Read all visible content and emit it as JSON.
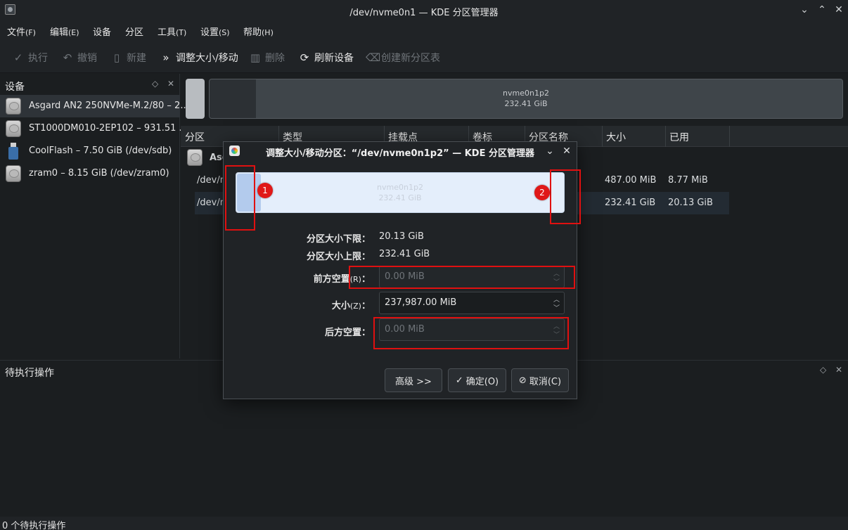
{
  "window": {
    "title": "/dev/nvme0n1 — KDE 分区管理器"
  },
  "menubar": [
    {
      "label": "文件",
      "accel": "(F)"
    },
    {
      "label": "编辑",
      "accel": "(E)"
    },
    {
      "label": "设备",
      "accel": ""
    },
    {
      "label": "分区",
      "accel": ""
    },
    {
      "label": "工具",
      "accel": "(T)"
    },
    {
      "label": "设置",
      "accel": "(S)"
    },
    {
      "label": "帮助",
      "accel": "(H)"
    }
  ],
  "toolbar": [
    {
      "label": "执行",
      "icon": "check-icon",
      "enabled": false
    },
    {
      "label": "撤销",
      "icon": "undo-icon",
      "enabled": false
    },
    {
      "label": "新建",
      "icon": "new-doc-icon",
      "enabled": false
    },
    {
      "label": "调整大小/移动",
      "icon": "resize-icon",
      "enabled": true
    },
    {
      "label": "删除",
      "icon": "trash-icon",
      "enabled": false
    },
    {
      "label": "刷新设备",
      "icon": "refresh-icon",
      "enabled": true
    },
    {
      "label": "创建新分区表",
      "icon": "erase-icon",
      "enabled": false
    }
  ],
  "devices": {
    "header": "设备",
    "items": [
      {
        "label": "Asgard AN2 250NVMe-M.2/80 – 2...",
        "icon": "disk-icon",
        "selected": true
      },
      {
        "label": "ST1000DM010-2EP102 – 931.51 ...",
        "icon": "disk-icon",
        "selected": false
      },
      {
        "label": "CoolFlash – 7.50 GiB (/dev/sdb)",
        "icon": "usb-icon",
        "selected": false
      },
      {
        "label": "zram0 – 8.15 GiB (/dev/zram0)",
        "icon": "disk-icon",
        "selected": false
      }
    ]
  },
  "partition_graph": {
    "name": "nvme0n1p2",
    "size": "232.41 GiB"
  },
  "table": {
    "columns": [
      "分区",
      "类型",
      "挂载点",
      "卷标",
      "分区名称",
      "大小",
      "已用"
    ],
    "device_row": "Asgard",
    "rows": [
      {
        "partition": "/dev/n",
        "size": "487.00 MiB",
        "used": "8.77 MiB",
        "selected": false
      },
      {
        "partition": "/dev/n",
        "size": "232.41 GiB",
        "used": "20.13 GiB",
        "selected": true
      }
    ]
  },
  "pending": {
    "header": "待执行操作"
  },
  "statusbar": {
    "text": "0 个待执行操作"
  },
  "dialog": {
    "title": "调整大小/移动分区：“/dev/nvme0n1p2” — KDE 分区管理器",
    "resizer": {
      "name": "nvme0n1p2",
      "size": "232.41 GiB"
    },
    "markers": [
      "1",
      "2"
    ],
    "min_size_label": "分区大小下限：",
    "min_size_value": "20.13 GiB",
    "max_size_label": "分区大小上限：",
    "max_size_value": "232.41 GiB",
    "free_before_label": "前方空置",
    "free_before_accel": "(R)",
    "free_before_value": "0.00 MiB",
    "size_label": "大小",
    "size_accel": "(Z)",
    "size_value": "237,987.00 MiB",
    "free_after_label": "后方空置：",
    "free_after_value": "0.00 MiB",
    "buttons": {
      "advanced": "高级 >>",
      "ok": "确定(O)",
      "cancel": "取消(C)"
    }
  }
}
